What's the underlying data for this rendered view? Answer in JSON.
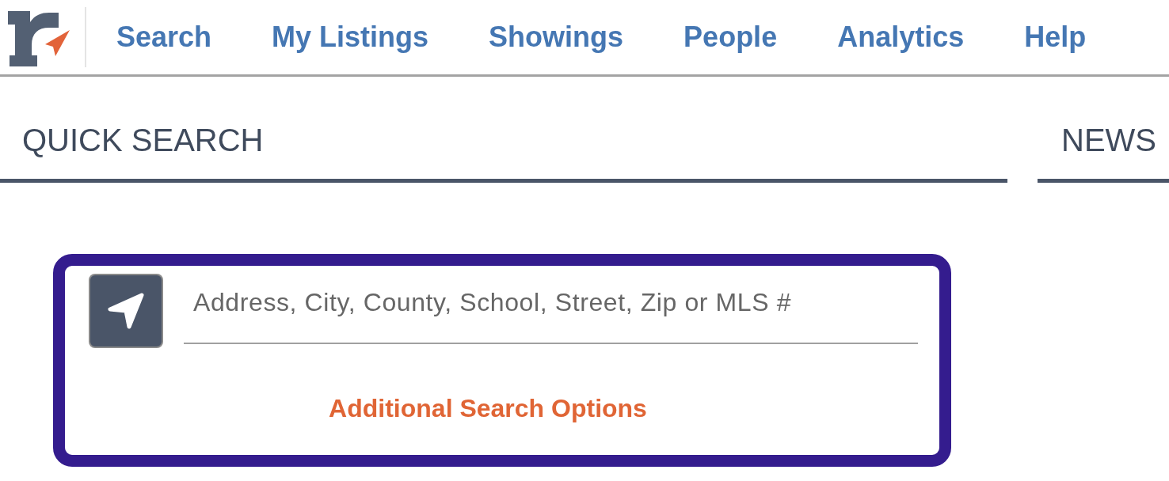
{
  "nav": {
    "items": [
      {
        "label": "Search"
      },
      {
        "label": "My Listings"
      },
      {
        "label": "Showings"
      },
      {
        "label": "People"
      },
      {
        "label": "Analytics"
      },
      {
        "label": "Help"
      }
    ]
  },
  "sections": [
    {
      "title": "QUICK SEARCH"
    },
    {
      "title": "NEWS"
    }
  ],
  "quick_search": {
    "placeholder": "Address, City, County, School, Street, Zip or MLS #",
    "link": "Additional Search Options"
  }
}
